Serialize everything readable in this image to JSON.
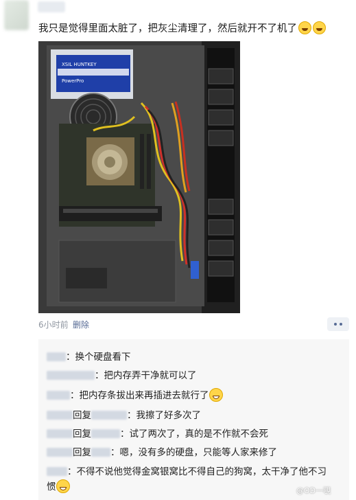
{
  "post": {
    "text": "我只是觉得里面太脏了，把灰尘清理了，然后就开不了机了",
    "emojis": [
      "laugh-cry-emoji",
      "laugh-cry-emoji"
    ],
    "photo": {
      "psu_label": "XSIL HUNTKEY",
      "psu_model": "PowerPro"
    },
    "time": "6小时前",
    "delete_label": "删除"
  },
  "comments": [
    {
      "text": "：换个硬盘看下"
    },
    {
      "text": "：把内存弄干净就可以了"
    },
    {
      "text": "：把内存条拔出来再插进去就行了",
      "emoji": "grin-emoji"
    },
    {
      "reply": "回复",
      "text": "：我擦了好多次了"
    },
    {
      "reply": "回复",
      "text": "：试了两次了，真的是不作就不会死"
    },
    {
      "reply": "回复",
      "text": "：嗯，没有多的硬盘，只能等人家来修了"
    },
    {
      "text": "：不得不说他觉得金窝银窝比不得自己的狗窝，太干净了他不习",
      "text2": "惯",
      "emoji": "grin-emoji"
    }
  ],
  "watermark": "@OD一覗"
}
